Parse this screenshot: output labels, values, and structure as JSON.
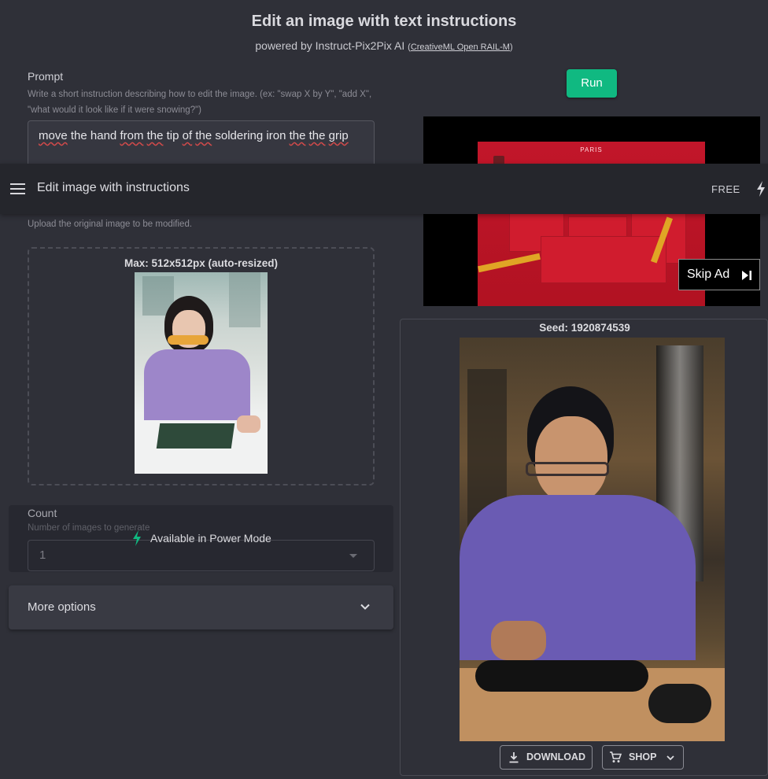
{
  "header": {
    "title": "Edit an image with text instructions",
    "subtitle_prefix": "powered by Instruct-Pix2Pix AI",
    "license_open": "(",
    "license_link": "CreativeML Open RAIL-M",
    "license_close": ")"
  },
  "prompt": {
    "label": "Prompt",
    "help": "Write a short instruction describing how to edit the image. (ex: \"swap X by Y\", \"add X\", \"what would it look like if it were snowing?\")",
    "value_words": [
      "move",
      "the",
      "hand",
      "from",
      "the",
      "tip",
      "of",
      "the",
      "soldering",
      "iron",
      "the",
      "the",
      "grip"
    ],
    "misspelled": [
      0,
      3,
      4,
      6,
      7,
      10,
      11,
      12
    ]
  },
  "run_button": {
    "label": "Run"
  },
  "navbar": {
    "title": "Edit image with instructions",
    "plan_badge": "FREE",
    "menu_icon": "hamburger-menu-icon",
    "bolt_icon": "lightning-bolt-icon"
  },
  "upload": {
    "help": "Upload the original image to be modified.",
    "max_text": "Max: 512x512px (auto-resized)"
  },
  "count": {
    "label": "Count",
    "help": "Number of images to generate",
    "value": "1",
    "power_mode": "Available in Power Mode"
  },
  "more_options": {
    "label": "More options"
  },
  "ad": {
    "brand_text": "PARIS",
    "skip_label": "Skip Ad",
    "skip_icon": "skip-next-icon"
  },
  "result": {
    "seed_label": "Seed: 1920874539",
    "download_label": "DOWNLOAD",
    "shop_label": "SHOP"
  },
  "colors": {
    "background": "#2f3038",
    "accent_green": "#10b981",
    "navbar": "#25262c",
    "panel": "#393a43"
  }
}
